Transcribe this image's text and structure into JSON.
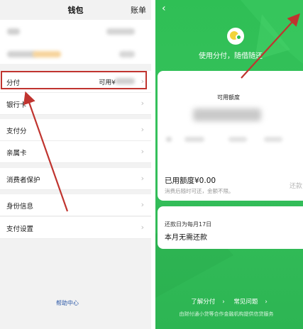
{
  "wallet": {
    "title": "钱包",
    "bill_link": "账单",
    "rows": [
      {
        "label": "分付",
        "right_text": "可用¥"
      },
      {
        "label": "银行卡"
      },
      {
        "label": "支付分"
      },
      {
        "label": "亲属卡"
      },
      {
        "label": "消费者保护"
      },
      {
        "label": "身份信息"
      },
      {
        "label": "支付设置"
      }
    ],
    "help_center": "帮助中心"
  },
  "fenfu": {
    "slogan": "使用分付，随借随还",
    "available_limit_label": "可用额度",
    "used_limit": "已用额度¥0.00",
    "note": "消费后随时可还，金额不限。",
    "repay_button": "还款",
    "due_day": "还款日为每月17日",
    "no_repay": "本月无需还款",
    "links": [
      "了解分付",
      "常见问题"
    ],
    "footer": "由财付通小贷等合作金融机构提供信贷服务"
  },
  "colors": {
    "accent_green": "#2fbf55",
    "highlight_red": "#c0342f",
    "link_blue": "#2e5aa8"
  },
  "icons": [
    "chevron-right-icon",
    "back-arrow-icon",
    "fenfu-logo-icon"
  ]
}
